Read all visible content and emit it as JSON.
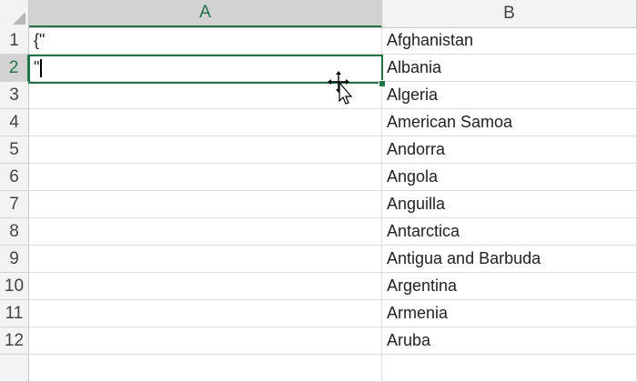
{
  "columns": [
    "A",
    "B"
  ],
  "rows": [
    {
      "num": "1",
      "a": "{\"",
      "b": "Afghanistan"
    },
    {
      "num": "2",
      "a": "\"",
      "b": "Albania"
    },
    {
      "num": "3",
      "a": "",
      "b": "Algeria"
    },
    {
      "num": "4",
      "a": "",
      "b": "American Samoa"
    },
    {
      "num": "5",
      "a": "",
      "b": "Andorra"
    },
    {
      "num": "6",
      "a": "",
      "b": "Angola"
    },
    {
      "num": "7",
      "a": "",
      "b": "Anguilla"
    },
    {
      "num": "8",
      "a": "",
      "b": "Antarctica"
    },
    {
      "num": "9",
      "a": "",
      "b": "Antigua and Barbuda"
    },
    {
      "num": "10",
      "a": "",
      "b": "Argentina"
    },
    {
      "num": "11",
      "a": "",
      "b": "Armenia"
    },
    {
      "num": "12",
      "a": "",
      "b": "Aruba"
    }
  ],
  "selection": {
    "active_column": "A",
    "active_row": "2"
  },
  "colors": {
    "accent": "#217346",
    "header_bg": "#f3f3f3",
    "header_selected_bg": "#d2d2d2",
    "gridline": "#dcdcdc"
  },
  "icons": {
    "select_all": "select-all-triangle-icon",
    "cursor": "move-cursor-icon"
  }
}
